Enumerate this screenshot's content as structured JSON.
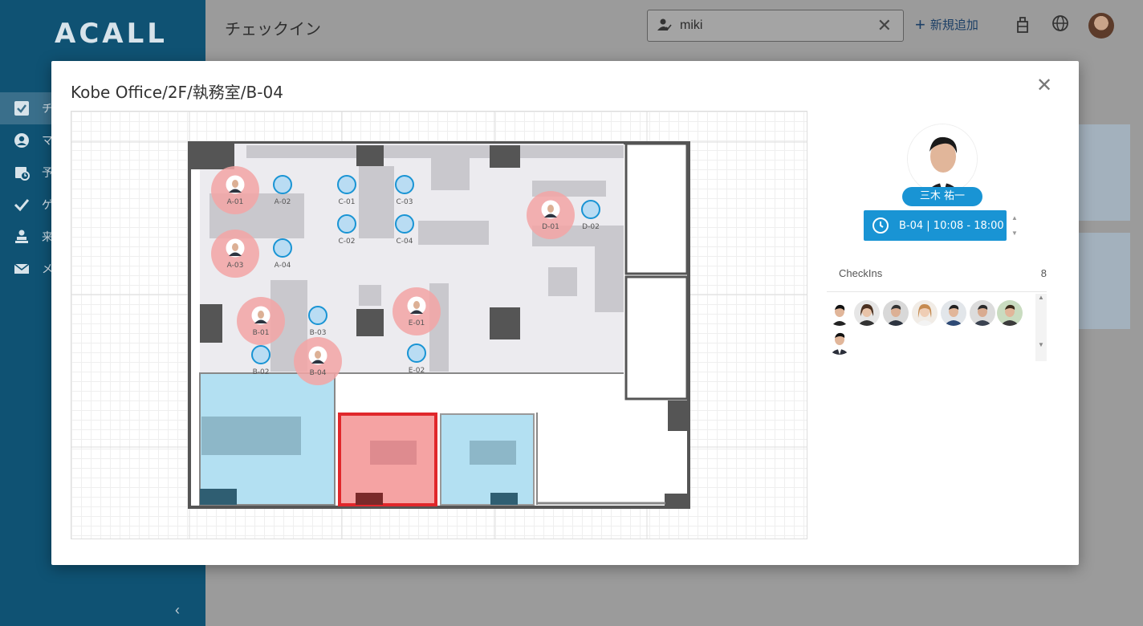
{
  "app": {
    "logo": "ACALL",
    "page_title": "チェックイン",
    "search": {
      "value": "miki"
    },
    "add_new_label": "新規追加",
    "sidebar": {
      "items": [
        {
          "icon": "checkbox-icon",
          "label": "チ"
        },
        {
          "icon": "user-circle-icon",
          "label": "マ"
        },
        {
          "icon": "calendar-clock-icon",
          "label": "予"
        },
        {
          "icon": "check-icon",
          "label": "ゲ"
        },
        {
          "icon": "person-desk-icon",
          "label": "来"
        },
        {
          "icon": "mail-icon",
          "label": "メ"
        }
      ],
      "collapse_icon": "chevron-left-icon"
    }
  },
  "modal": {
    "title": "Kobe Office/2F/執務室/B-04",
    "close_icon": "close-icon",
    "floor_map": {
      "seats": [
        {
          "id": "A-01",
          "occupied": true
        },
        {
          "id": "A-02",
          "occupied": false
        },
        {
          "id": "A-03",
          "occupied": true
        },
        {
          "id": "A-04",
          "occupied": false
        },
        {
          "id": "C-01",
          "occupied": false
        },
        {
          "id": "C-02",
          "occupied": false
        },
        {
          "id": "C-03",
          "occupied": false
        },
        {
          "id": "C-04",
          "occupied": false
        },
        {
          "id": "D-01",
          "occupied": true
        },
        {
          "id": "D-02",
          "occupied": false
        },
        {
          "id": "B-01",
          "occupied": true
        },
        {
          "id": "B-02",
          "occupied": false
        },
        {
          "id": "B-03",
          "occupied": false
        },
        {
          "id": "B-04",
          "occupied": true
        },
        {
          "id": "E-01",
          "occupied": true
        },
        {
          "id": "E-02",
          "occupied": false
        }
      ],
      "selected_seat": "B-04",
      "colors": {
        "occupied": "#f3a5a5",
        "free": "#b9dcf3",
        "free_border": "#1994d4",
        "selected_room": "#f5a3a3",
        "meeting_room": "#b3e0f2"
      }
    },
    "user": {
      "name": "三木 祐一",
      "booking": "B-04 | 10:08 - 18:00"
    },
    "checkins": {
      "label": "CheckIns",
      "count": "8"
    }
  }
}
